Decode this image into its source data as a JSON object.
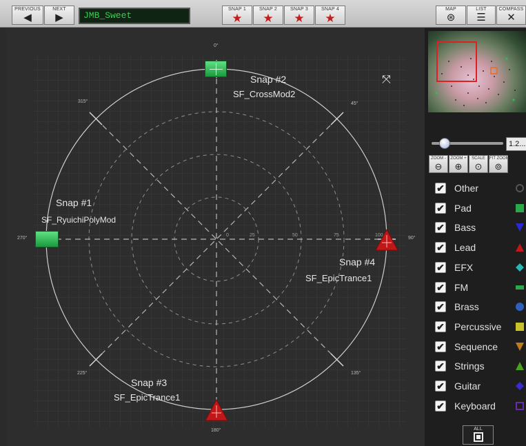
{
  "toolbar": {
    "previous_label": "PREVIOUS",
    "next_label": "NEXT",
    "patch_name": "JMB_Sweet",
    "snap_buttons": [
      "SNAP 1",
      "SNAP 2",
      "SNAP 3",
      "SNAP 4"
    ],
    "map_label": "MAP",
    "list_label": "LIST",
    "compass_label": "COMPASS"
  },
  "compass": {
    "degree_labels": {
      "d0": "0°",
      "d45": "45°",
      "d90": "90°",
      "d135": "135°",
      "d180": "180°",
      "d225": "225°",
      "d270": "270°",
      "d315": "315°"
    },
    "ring_labels": [
      "0",
      "25",
      "50",
      "75",
      "100"
    ],
    "snaps": [
      {
        "label": "Snap #1",
        "name": "SF_RyuichiPolyMod",
        "shape": "square",
        "color": "#2fbf55"
      },
      {
        "label": "Snap #2",
        "name": "SF_CrossMod2",
        "shape": "square",
        "color": "#2fbf55"
      },
      {
        "label": "Snap #3",
        "name": "SF_EpicTrance1",
        "shape": "triangle",
        "color": "#c01818"
      },
      {
        "label": "Snap #4",
        "name": "SF_EpicTrance1",
        "shape": "triangle",
        "color": "#c01818"
      }
    ]
  },
  "panel": {
    "zoom_value": "1.2...",
    "zoom_buttons": [
      "ZOOM -",
      "ZOOM +",
      "SCALE",
      "FIT ZOOM"
    ],
    "legend": [
      {
        "label": "Other",
        "icon": "circle-outline",
        "color": "#555555"
      },
      {
        "label": "Pad",
        "icon": "square",
        "color": "#2aa84a"
      },
      {
        "label": "Bass",
        "icon": "triangle-down",
        "color": "#2a2ad0"
      },
      {
        "label": "Lead",
        "icon": "triangle",
        "color": "#c01818"
      },
      {
        "label": "EFX",
        "icon": "diamond",
        "color": "#28b7b7"
      },
      {
        "label": "FM",
        "icon": "rect",
        "color": "#2aa84a"
      },
      {
        "label": "Brass",
        "icon": "circle",
        "color": "#2f5fbf"
      },
      {
        "label": "Percussive",
        "icon": "square",
        "color": "#c9c12a"
      },
      {
        "label": "Sequence",
        "icon": "triangle-down",
        "color": "#c07a1a"
      },
      {
        "label": "Strings",
        "icon": "triangle",
        "color": "#4aa020"
      },
      {
        "label": "Guitar",
        "icon": "diamond",
        "color": "#3a2ad0"
      },
      {
        "label": "Keyboard",
        "icon": "square-outline",
        "color": "#6a2ab0"
      }
    ],
    "all_label": "ALL",
    "checkmark": "✔"
  }
}
